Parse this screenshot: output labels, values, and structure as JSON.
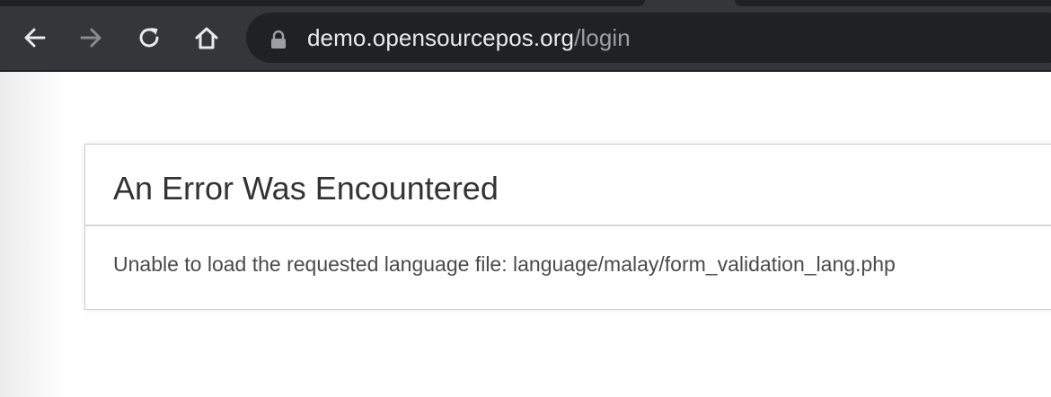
{
  "browser": {
    "url_host": "demo.opensourcepos.org",
    "url_path": "/login",
    "icons": {
      "back": "arrow-left-icon",
      "forward": "arrow-right-icon",
      "reload": "reload-icon",
      "home": "home-icon",
      "lock": "lock-icon"
    },
    "colors": {
      "toolbar": "#35363a",
      "omnibox": "#202124",
      "url_text": "#e8eaed",
      "url_path": "#9aa0a6"
    }
  },
  "error": {
    "title": "An Error Was Encountered",
    "message": "Unable to load the requested language file: language/malay/form_validation_lang.php"
  }
}
